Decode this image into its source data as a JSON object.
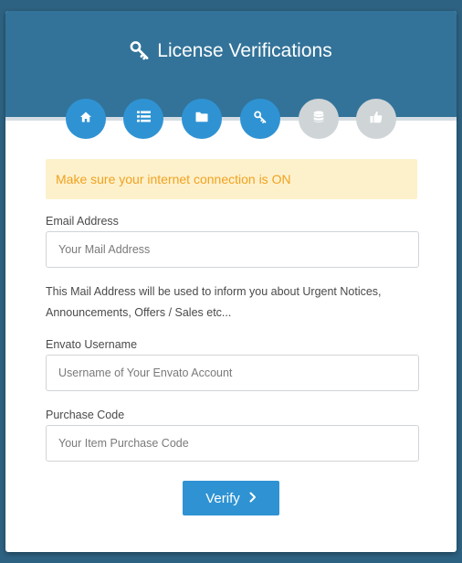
{
  "header": {
    "title": "License Verifications",
    "title_icon": "key-icon"
  },
  "steps": [
    {
      "icon": "home-icon",
      "state": "active"
    },
    {
      "icon": "list-icon",
      "state": "active"
    },
    {
      "icon": "folder-icon",
      "state": "active"
    },
    {
      "icon": "key-icon",
      "state": "active"
    },
    {
      "icon": "database-icon",
      "state": "inactive"
    },
    {
      "icon": "thumbs-up-icon",
      "state": "inactive"
    }
  ],
  "alert": {
    "text": "Make sure your internet connection is ON"
  },
  "form": {
    "email_label": "Email Address",
    "email_placeholder": "Your Mail Address",
    "email_help": "This Mail Address will be used to inform you about Urgent Notices, Announcements, Offers / Sales etc...",
    "username_label": "Envato Username",
    "username_placeholder": "Username of Your Envato Account",
    "purchase_label": "Purchase Code",
    "purchase_placeholder": "Your Item Purchase Code",
    "verify_label": "Verify"
  },
  "colors": {
    "page_background": "#2e6282",
    "header": "#337399",
    "step_active": "#2f93d3",
    "step_inactive": "#cfd4d7",
    "alert_background": "#fdf1cc",
    "alert_text": "#f0a21f",
    "button": "#2f93d3"
  }
}
